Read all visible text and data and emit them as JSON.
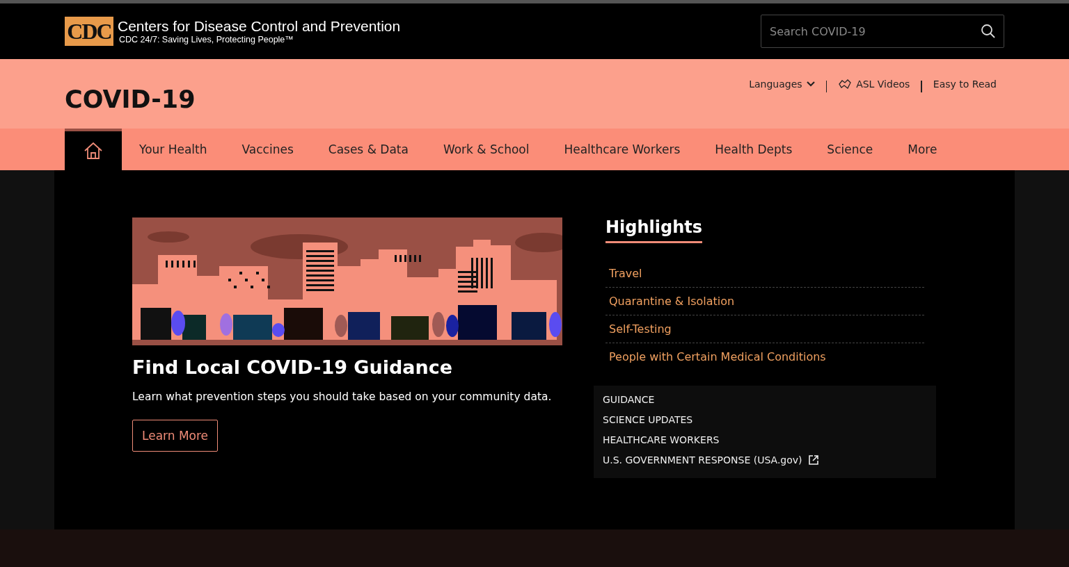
{
  "header": {
    "logo_text": "CDC",
    "title": "Centers for Disease Control and Prevention",
    "tagline": "CDC 24/7: Saving Lives, Protecting People™",
    "search": {
      "placeholder": "Search COVID-19"
    }
  },
  "banner": {
    "title": "COVID-19",
    "links": [
      {
        "label": "Languages",
        "kind": "dropdown"
      },
      {
        "label": "ASL Videos",
        "kind": "asl"
      },
      {
        "label": "Easy to Read",
        "kind": "plain"
      }
    ]
  },
  "nav": [
    {
      "kind": "home",
      "selected": true
    },
    {
      "label": "Your Health",
      "kind": "text",
      "selected": false
    },
    {
      "label": "Vaccines",
      "kind": "text",
      "selected": false
    },
    {
      "label": "Cases & Data",
      "kind": "text",
      "selected": false
    },
    {
      "label": "Work & School",
      "kind": "text",
      "selected": false
    },
    {
      "label": "Healthcare Workers",
      "kind": "text",
      "selected": false
    },
    {
      "label": "Health Depts",
      "kind": "text",
      "selected": false
    },
    {
      "label": "Science",
      "kind": "text",
      "selected": false
    },
    {
      "label": "More",
      "kind": "text",
      "selected": false
    }
  ],
  "feature": {
    "heading": "Find Local COVID-19 Guidance",
    "text": "Learn what prevention steps you should take based on your community data.",
    "button": "Learn More"
  },
  "highlights": {
    "title": "Highlights",
    "items": [
      "Travel",
      "Quarantine & Isolation",
      "Self-Testing",
      "People with Certain Medical Conditions"
    ]
  },
  "quick_links": [
    {
      "label": "GUIDANCE",
      "external": false
    },
    {
      "label": "SCIENCE UPDATES",
      "external": false
    },
    {
      "label": "HEALTHCARE WORKERS",
      "external": false
    },
    {
      "label": "U.S. GOVERNMENT RESPONSE (USA.gov)",
      "external": true
    }
  ]
}
